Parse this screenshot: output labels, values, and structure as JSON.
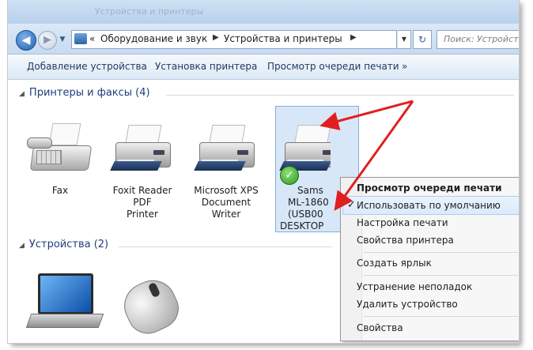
{
  "window": {
    "title_ghost": "Устройства и принтеры"
  },
  "nav": {
    "breadcrumb": [
      "Оборудование и звук",
      "Устройства и принтеры"
    ],
    "chevrons": "«",
    "search_placeholder": "Поиск: Устройст..."
  },
  "toolbar": {
    "items": [
      "Добавление устройства",
      "Установка принтера",
      "Просмотр очереди печати",
      "»"
    ]
  },
  "groups": {
    "printers": "Принтеры и факсы (4)",
    "devices": "Устройства (2)"
  },
  "printers": [
    {
      "label_lines": [
        "Fax"
      ],
      "icon": "fax-icon"
    },
    {
      "label_lines": [
        "Foxit Reader PDF",
        "Printer"
      ],
      "icon": "printer-icon"
    },
    {
      "label_lines": [
        "Microsoft XPS",
        "Document Writer"
      ],
      "icon": "printer-icon"
    },
    {
      "label_lines": [
        "Sams",
        "ML-1860",
        "(USB00",
        "DESKTOP"
      ],
      "icon": "printer-icon",
      "default": true,
      "selected": true
    }
  ],
  "devices": [
    {
      "icon": "laptop-icon"
    },
    {
      "icon": "mouse-icon"
    }
  ],
  "context_menu": {
    "items": [
      {
        "label": "Просмотр очереди печати",
        "bold": true
      },
      {
        "label": "Использовать по умолчанию",
        "checked": true,
        "highlighted": true
      },
      {
        "label": "Настройка печати"
      },
      {
        "label": "Свойства принтера"
      },
      {
        "label": "Создать ярлык"
      },
      {
        "label": "Устранение неполадок"
      },
      {
        "label": "Удалить устройство"
      },
      {
        "label": "Свойства"
      }
    ],
    "checkmark": "✓"
  },
  "colors": {
    "accent": "#1e3f7a",
    "selection": "#d8e7f8",
    "arrow": "#e02020"
  }
}
